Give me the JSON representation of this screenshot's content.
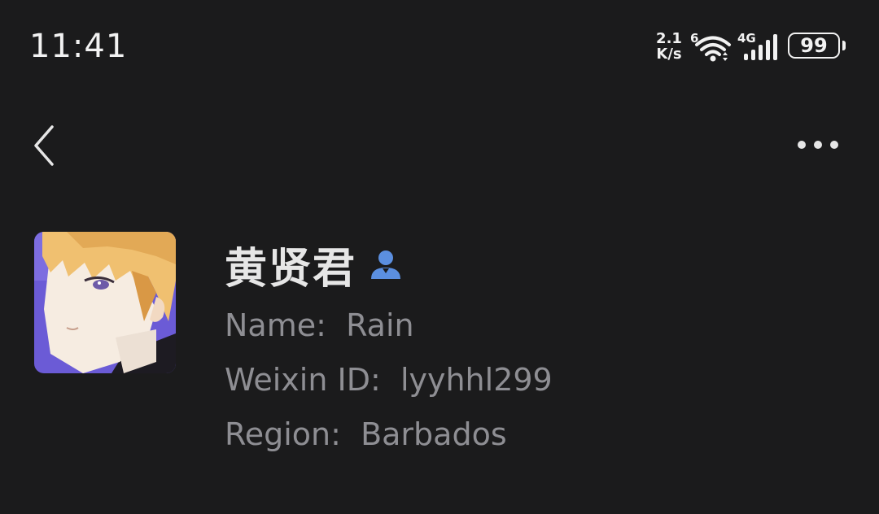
{
  "status_bar": {
    "time": "11:41",
    "net_speed_value": "2.1",
    "net_speed_unit": "K/s",
    "wifi_badge": "6",
    "cell_badge": "4G",
    "battery_level": "99"
  },
  "nav": {
    "back_icon": "chevron-left-icon",
    "more_icon": "more-horizontal-icon"
  },
  "profile": {
    "display_name": "黄贤君",
    "name_label": "Name:",
    "name_value": "Rain",
    "id_label": "Weixin ID:",
    "id_value": "lyyhhl299",
    "region_label": "Region:",
    "region_value": "Barbados",
    "contact_icon": "person-icon",
    "accent_color": "#5b8fe0"
  },
  "theme": {
    "background": "#1b1b1c",
    "primary_text": "#e6e6e6",
    "secondary_text": "#8e8e93"
  }
}
